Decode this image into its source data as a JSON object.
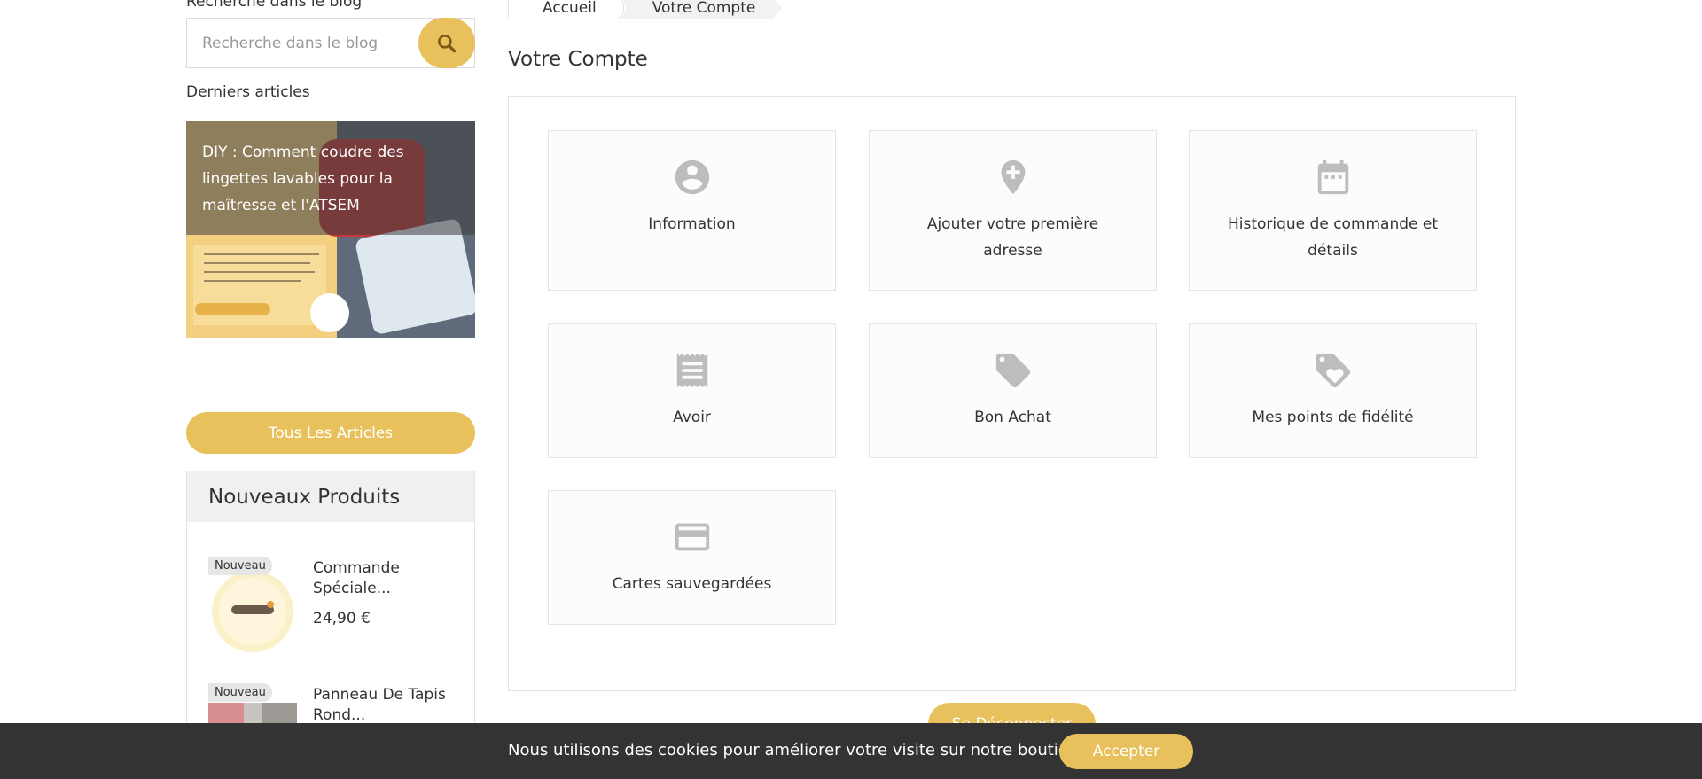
{
  "sidebar": {
    "blog_search_title": "Recherche dans le blog",
    "blog_search_placeholder": "Recherche dans le blog",
    "search_icon": "search-icon",
    "latest_title": "Derniers articles",
    "article": {
      "title": "DIY : Comment coudre des lingettes lavables pour la maîtresse et l'ATSEM"
    },
    "all_articles_label": "Tous Les Articles",
    "new_products": {
      "title": "Nouveaux Produits",
      "items": [
        {
          "badge": "Nouveau",
          "name": "Commande Spéciale...",
          "price": "24,90 €"
        },
        {
          "badge": "Nouveau",
          "name": "Panneau De Tapis Rond...",
          "price": ""
        }
      ]
    }
  },
  "breadcrumb": {
    "items": [
      "Accueil",
      "Votre Compte"
    ]
  },
  "main": {
    "title": "Votre Compte",
    "tiles": [
      {
        "label": "Information",
        "icon": "account-circle-icon"
      },
      {
        "label": "Ajouter votre première adresse",
        "icon": "add-location-icon"
      },
      {
        "label": "Historique de commande et détails",
        "icon": "calendar-icon"
      },
      {
        "label": "Avoir",
        "icon": "receipt-icon"
      },
      {
        "label": "Bon Achat",
        "icon": "tag-icon"
      },
      {
        "label": "Mes points de fidélité",
        "icon": "loyalty-tag-icon"
      },
      {
        "label": "Cartes sauvegardées",
        "icon": "credit-card-icon"
      }
    ],
    "logout_label": "Se Déconnecter"
  },
  "cookie": {
    "text": "Nous utilisons des cookies pour améliorer votre visite sur notre boutique",
    "accept_label": "Accepter"
  },
  "colors": {
    "accent": "#e8c05c",
    "cookie_bg": "#333333",
    "icon": "#bdbdbd"
  }
}
